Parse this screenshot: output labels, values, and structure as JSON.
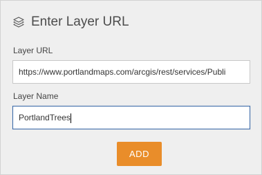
{
  "header": {
    "icon": "layers-icon",
    "title": "Enter Layer URL"
  },
  "layer_url": {
    "label": "Layer URL",
    "value": "https://www.portlandmaps.com/arcgis/rest/services/Publi"
  },
  "layer_name": {
    "label": "Layer Name",
    "value": "PortlandTrees"
  },
  "actions": {
    "add_label": "ADD"
  },
  "colors": {
    "panel_background": "#efefef",
    "add_button": "#e98d2a",
    "focus_border": "#3b6aa8"
  }
}
